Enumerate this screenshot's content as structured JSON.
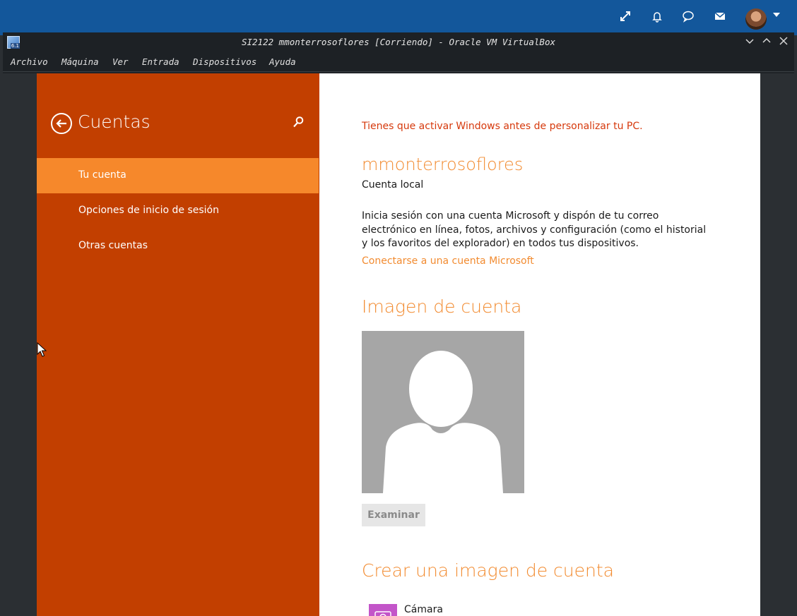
{
  "host": {
    "icons": [
      "expand-icon",
      "bell-icon",
      "chat-icon",
      "mail-icon",
      "avatar",
      "caret-down-icon"
    ]
  },
  "window": {
    "title": "SI2122 mmonterrosoflores [Corriendo] - Oracle VM VirtualBox",
    "logo_badge": "6.1",
    "menu": [
      "Archivo",
      "Máquina",
      "Ver",
      "Entrada",
      "Dispositivos",
      "Ayuda"
    ]
  },
  "settings": {
    "pane_title": "Cuentas",
    "nav": [
      {
        "label": "Tu cuenta",
        "active": true
      },
      {
        "label": "Opciones de inicio de sesión",
        "active": false
      },
      {
        "label": "Otras cuentas",
        "active": false
      }
    ]
  },
  "account": {
    "activation_warning": "Tienes que activar Windows antes de personalizar tu PC.",
    "username": "mmonterrosoflores",
    "account_type": "Cuenta local",
    "description": "Inicia sesión con una cuenta Microsoft y dispón de tu correo electrónico en línea, fotos, archivos y configuración (como el historial y los favoritos del explorador) en todos tus dispositivos.",
    "connect_link": "Conectarse a una cuenta Microsoft",
    "image_heading": "Imagen de cuenta",
    "browse_button": "Examinar",
    "create_heading": "Crear una imagen de cuenta",
    "camera_label": "Cámara"
  },
  "colors": {
    "host_bar": "#13579b",
    "left_pane": "#c23f00",
    "nav_active": "#f6882b",
    "accent": "#f28b30",
    "warning": "#d6390c"
  }
}
